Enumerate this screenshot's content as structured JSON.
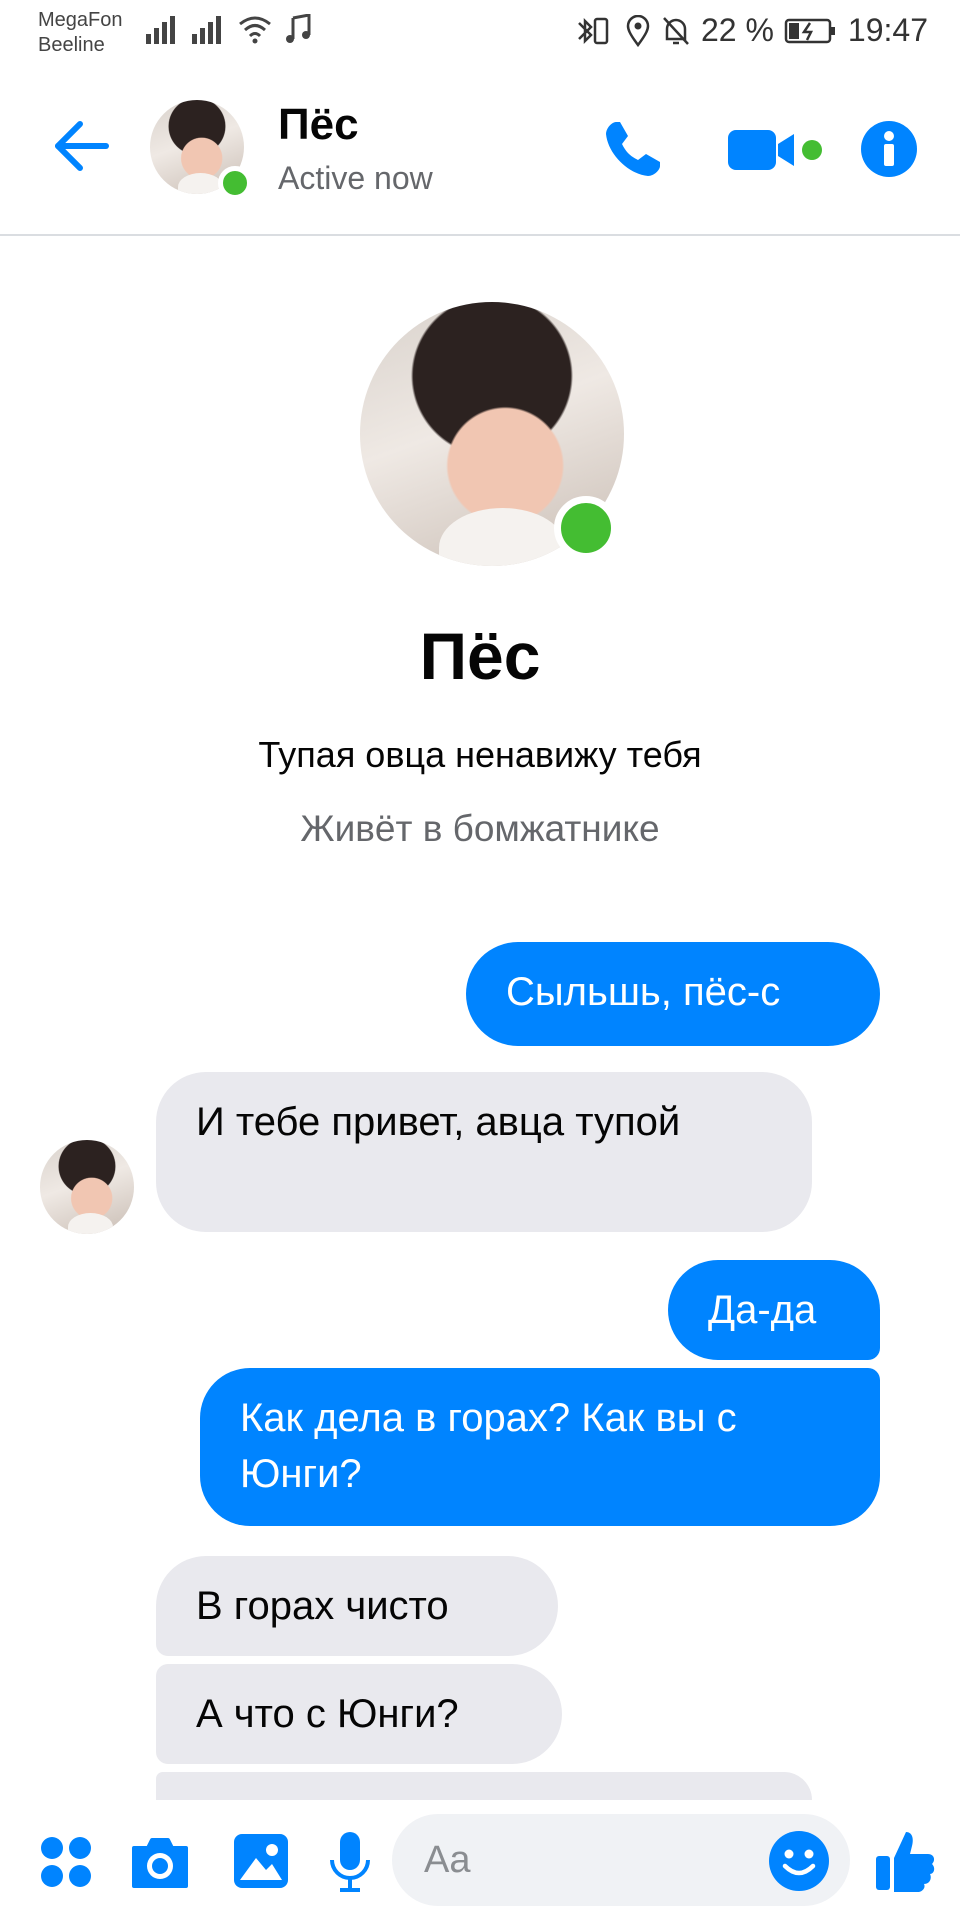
{
  "status_bar": {
    "carrier_1": "MegaFon",
    "carrier_2": "Beeline",
    "battery": "22 %",
    "time": "19:47"
  },
  "header": {
    "contact_name": "Пёс",
    "status": "Active now"
  },
  "profile": {
    "name": "Пёс",
    "bio": "Тупая овца ненавижу тебя",
    "location": "Живёт в бомжатнике"
  },
  "messages": [
    {
      "from": "me",
      "text": "Сыльшь, пёс-с"
    },
    {
      "from": "them",
      "text": "И тебе привет, авца тупой"
    },
    {
      "from": "me",
      "text": "Да-да"
    },
    {
      "from": "me",
      "text": "Как дела в горах? Как вы с Юнги?"
    },
    {
      "from": "them",
      "text": "В горах чисто"
    },
    {
      "from": "them",
      "text": "А что с Юнги?"
    }
  ],
  "composer": {
    "placeholder": "Aa"
  },
  "colors": {
    "accent": "#0084ff",
    "outgoing_bubble": "#0084ff",
    "incoming_bubble": "#e9e9ee",
    "online": "#44bd32",
    "secondary_text": "#65676b"
  },
  "icons": {
    "back": "arrow-left-icon",
    "call": "phone-icon",
    "video": "video-camera-icon",
    "info": "info-icon",
    "menu": "four-dots-icon",
    "camera": "camera-icon",
    "gallery": "image-icon",
    "mic": "microphone-icon",
    "emoji": "emoji-icon",
    "like": "thumbs-up-icon"
  }
}
